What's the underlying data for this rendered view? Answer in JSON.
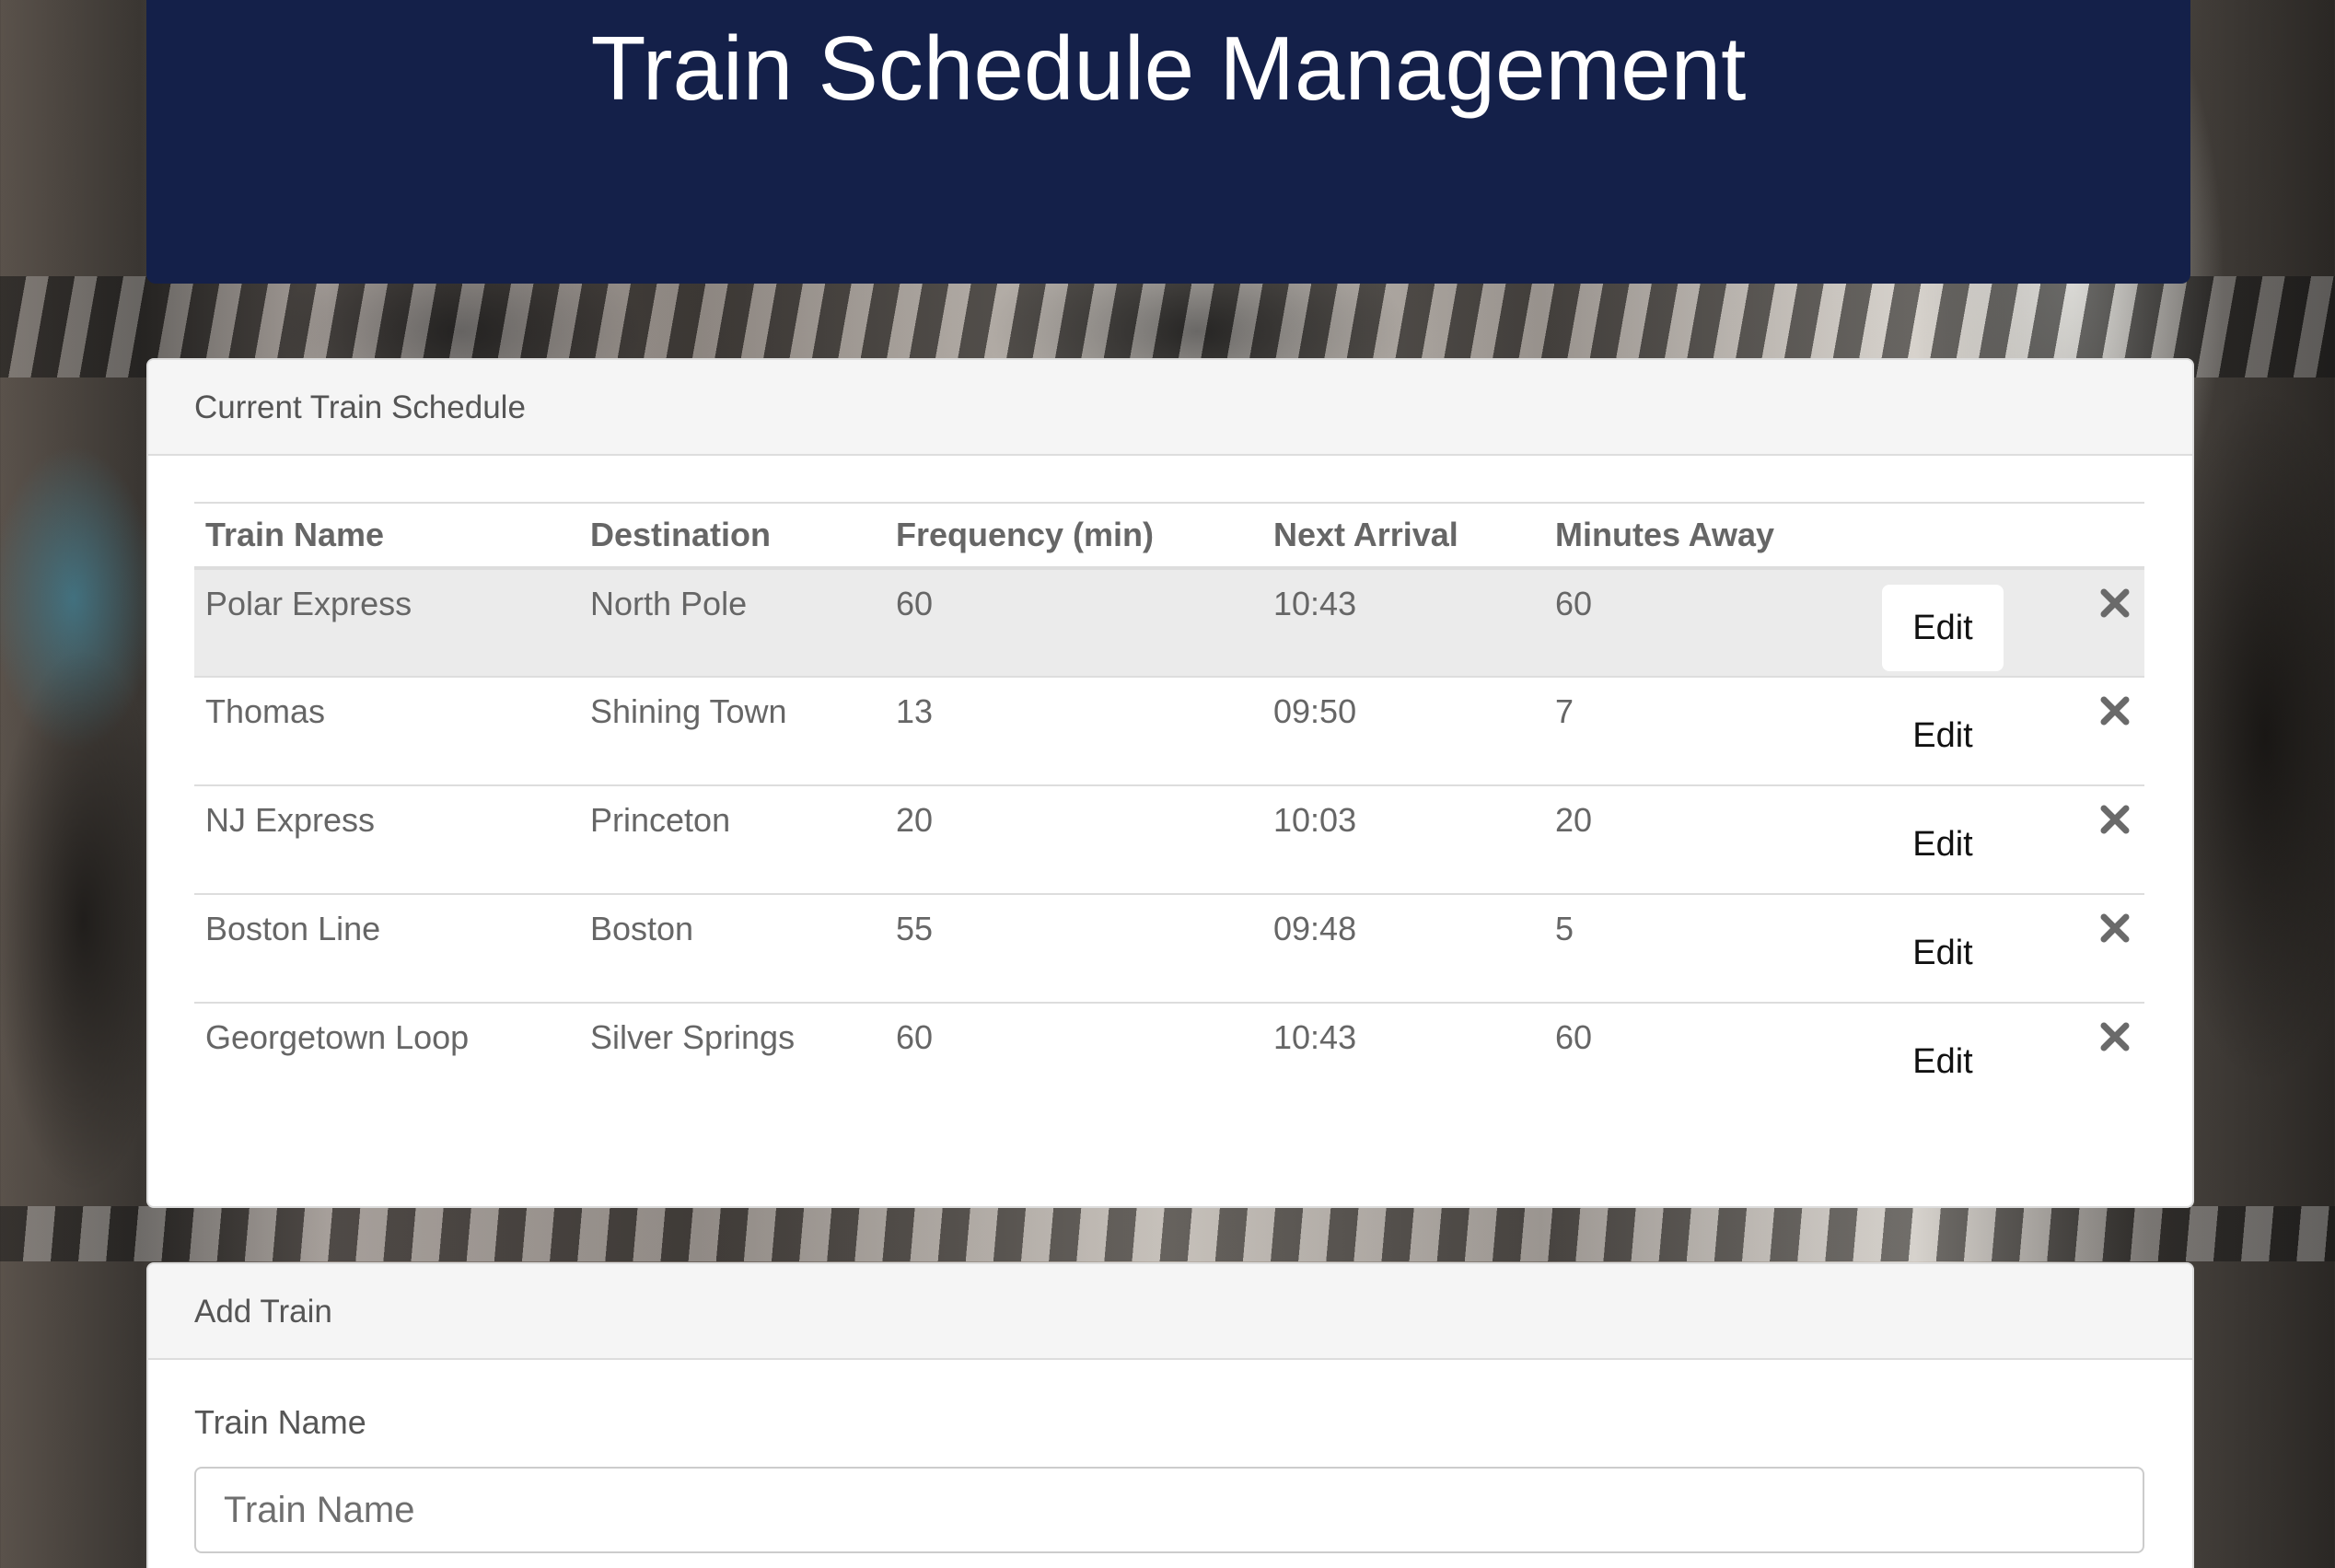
{
  "header": {
    "title": "Train Schedule Management"
  },
  "schedule_panel": {
    "title": "Current Train Schedule",
    "columns": [
      "Train Name",
      "Destination",
      "Frequency (min)",
      "Next Arrival",
      "Minutes Away"
    ],
    "rows": [
      {
        "name": "Polar Express",
        "destination": "North Pole",
        "frequency": "60",
        "next_arrival": "10:43",
        "minutes_away": "60",
        "edit": "Edit"
      },
      {
        "name": "Thomas",
        "destination": "Shining Town",
        "frequency": "13",
        "next_arrival": "09:50",
        "minutes_away": "7",
        "edit": "Edit"
      },
      {
        "name": "NJ Express",
        "destination": "Princeton",
        "frequency": "20",
        "next_arrival": "10:03",
        "minutes_away": "20",
        "edit": "Edit"
      },
      {
        "name": "Boston Line",
        "destination": "Boston",
        "frequency": "55",
        "next_arrival": "09:48",
        "minutes_away": "5",
        "edit": "Edit"
      },
      {
        "name": "Georgetown Loop",
        "destination": "Silver Springs",
        "frequency": "60",
        "next_arrival": "10:43",
        "minutes_away": "60",
        "edit": "Edit"
      }
    ],
    "remove_icon": "close-icon"
  },
  "add_panel": {
    "title": "Add Train",
    "train_name_label": "Train Name",
    "train_name_placeholder": "Train Name",
    "train_name_value": ""
  },
  "colors": {
    "header_bg": "#142049",
    "panel_heading_bg": "#f5f5f5",
    "hover_row_bg": "#ebebeb",
    "text": "#666666"
  }
}
